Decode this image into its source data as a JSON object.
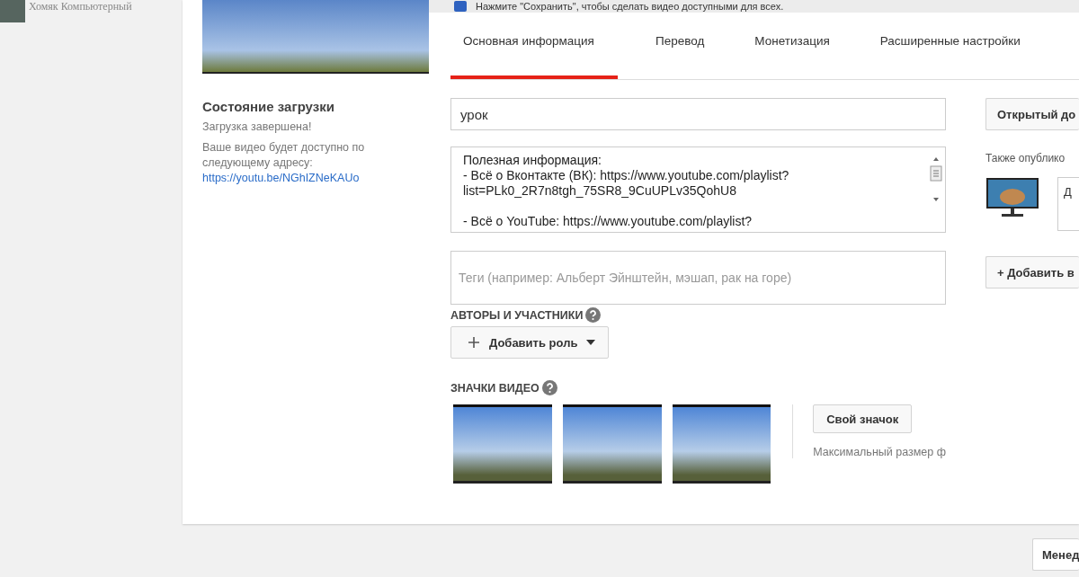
{
  "channel": {
    "name": "Хомяк Компьютерный"
  },
  "notice": {
    "text": "Нажмите \"Сохранить\", чтобы сделать видео доступными для всех."
  },
  "upload_status": {
    "title": "Состояние загрузки",
    "status": "Загрузка завершена!",
    "message": "Ваше видео будет доступно по следующему адресу:",
    "link": "https://youtu.be/NGhIZNeKAUo"
  },
  "tabs": [
    {
      "label": "Основная информация",
      "selected": true
    },
    {
      "label": "Перевод",
      "selected": false
    },
    {
      "label": "Монетизация",
      "selected": false
    },
    {
      "label": "Расширенные настройки",
      "selected": false
    }
  ],
  "title_field": {
    "value": "урок"
  },
  "description_field": {
    "value": "Полезная информация:\n- Всё о Вконтакте (ВК): https://www.youtube.com/playlist?list=PLk0_2R7n8tgh_75SR8_9CuUPLv35QohU8\n\n- Всё о YouTube: https://www.youtube.com/playlist?"
  },
  "tags_field": {
    "placeholder": "Теги (например: Альберт Эйнштейн, мэшап, рак на горе)"
  },
  "authors": {
    "heading": "АВТОРЫ И УЧАСТНИКИ",
    "add_button": "Добавить роль"
  },
  "thumbnails": {
    "heading": "ЗНАЧКИ ВИДЕО",
    "custom_button": "Свой значок",
    "note": "Максимальный размер ф"
  },
  "side": {
    "privacy_button": "Открытый до",
    "also_publish": "Также опублико",
    "share_text": "Д",
    "add_playlist_button": "+ Добавить в"
  },
  "footer": {
    "button": "Менед"
  }
}
